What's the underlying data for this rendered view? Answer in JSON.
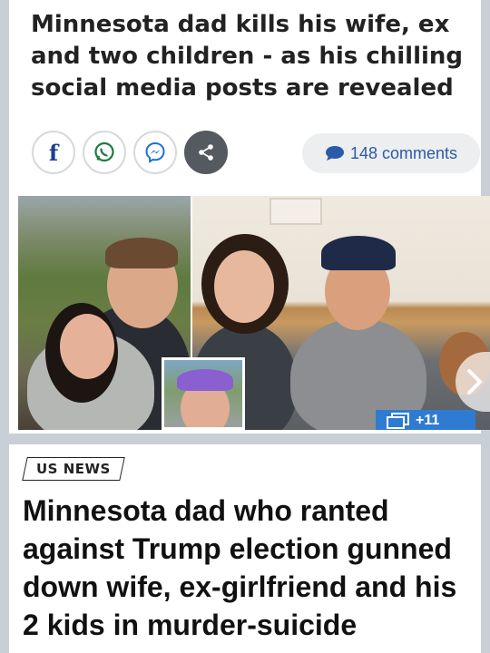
{
  "article": {
    "headline": "Minnesota dad kills his wife, ex and two children - as his chilling social media posts are revealed"
  },
  "share": {
    "buttons": [
      {
        "name": "facebook",
        "icon": "facebook-icon",
        "glyph": "f"
      },
      {
        "name": "whatsapp",
        "icon": "whatsapp-icon"
      },
      {
        "name": "messenger",
        "icon": "messenger-icon"
      },
      {
        "name": "share",
        "icon": "share-icon"
      }
    ],
    "comments_label": "148 comments"
  },
  "gallery": {
    "more_count": "+11",
    "next_icon": "chevron-right-icon"
  },
  "related": {
    "section_tag": "US NEWS",
    "headline": "Minnesota dad who ranted against Trump election gunned down wife, ex-girlfriend and his 2 kids in murder-suicide"
  },
  "colors": {
    "accent_blue": "#2f7bd1",
    "facebook": "#1d3d8f",
    "whatsapp": "#1f7a3d",
    "messenger": "#1b6fe0",
    "page_bg": "#c9cfd6"
  }
}
